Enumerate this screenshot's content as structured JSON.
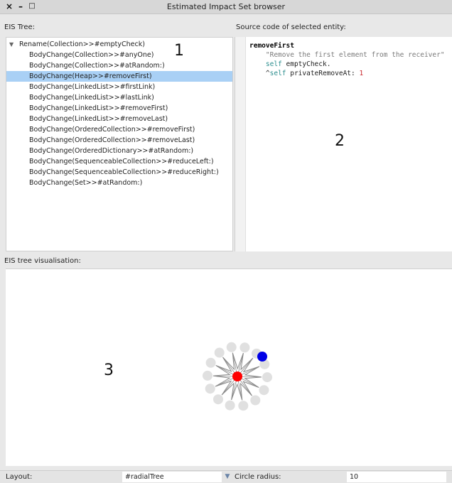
{
  "window": {
    "title": "Estimated Impact Set browser",
    "close_glyph": "×",
    "minimize_glyph": "–",
    "maximize_glyph": "□"
  },
  "tree": {
    "label": "EIS Tree:",
    "root": "Rename(Collection>>#emptyCheck)",
    "items": [
      "BodyChange(Collection>>#anyOne)",
      "BodyChange(Collection>>#atRandom:)",
      "BodyChange(Heap>>#removeFirst)",
      "BodyChange(LinkedList>>#firstLink)",
      "BodyChange(LinkedList>>#lastLink)",
      "BodyChange(LinkedList>>#removeFirst)",
      "BodyChange(LinkedList>>#removeLast)",
      "BodyChange(OrderedCollection>>#removeFirst)",
      "BodyChange(OrderedCollection>>#removeLast)",
      "BodyChange(OrderedDictionary>>#atRandom:)",
      "BodyChange(SequenceableCollection>>#reduceLeft:)",
      "BodyChange(SequenceableCollection>>#reduceRight:)",
      "BodyChange(Set>>#atRandom:)"
    ],
    "selected_index": 2
  },
  "source": {
    "label": "Source code of selected entity:",
    "selector": "removeFirst",
    "comment": "\"Remove the first element from the receiver\"",
    "line2_self": "self",
    "line2_rest": " emptyCheck.",
    "line3_caret": "^",
    "line3_self": "self",
    "line3_rest": " privateRemoveAt: ",
    "line3_num": "1"
  },
  "visualisation": {
    "label": "EIS tree visualisation:",
    "leaf_count": 14,
    "colors": {
      "center": "#ff0000",
      "selected": "#0000e6",
      "leaf": "#e0e0e0",
      "edge": "#8a8a8a"
    }
  },
  "markers": {
    "one": "1",
    "two": "2",
    "three": "3"
  },
  "footer": {
    "layout_label": "Layout:",
    "layout_value": "#radialTree",
    "dropdown_glyph": "▼",
    "radius_label": "Circle radius:",
    "radius_value": "10"
  }
}
